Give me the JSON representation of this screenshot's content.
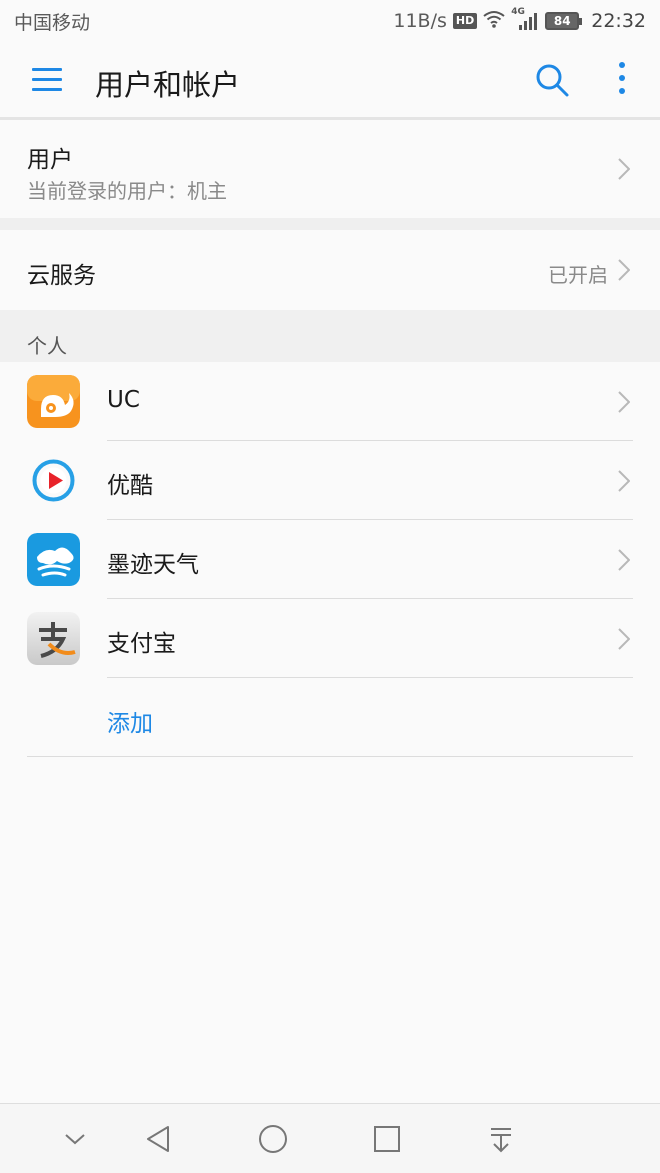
{
  "status_bar": {
    "carrier": "中国移动",
    "speed": "11B/s",
    "hd": "HD",
    "network": "4G",
    "battery": "84",
    "time": "22:32"
  },
  "app_bar": {
    "title": "用户和帐户"
  },
  "user_section": {
    "title": "用户",
    "subtitle": "当前登录的用户：机主"
  },
  "cloud_section": {
    "title": "云服务",
    "status": "已开启"
  },
  "personal_section": {
    "header": "个人",
    "accounts": [
      {
        "label": "UC",
        "icon": "uc-browser-icon"
      },
      {
        "label": "优酷",
        "icon": "youku-icon"
      },
      {
        "label": "墨迹天气",
        "icon": "moji-weather-icon"
      },
      {
        "label": "支付宝",
        "icon": "alipay-icon"
      }
    ],
    "add_label": "添加"
  },
  "colors": {
    "accent": "#1e88e5",
    "background": "#fafafa",
    "secondary_text": "#8a8a8a"
  }
}
